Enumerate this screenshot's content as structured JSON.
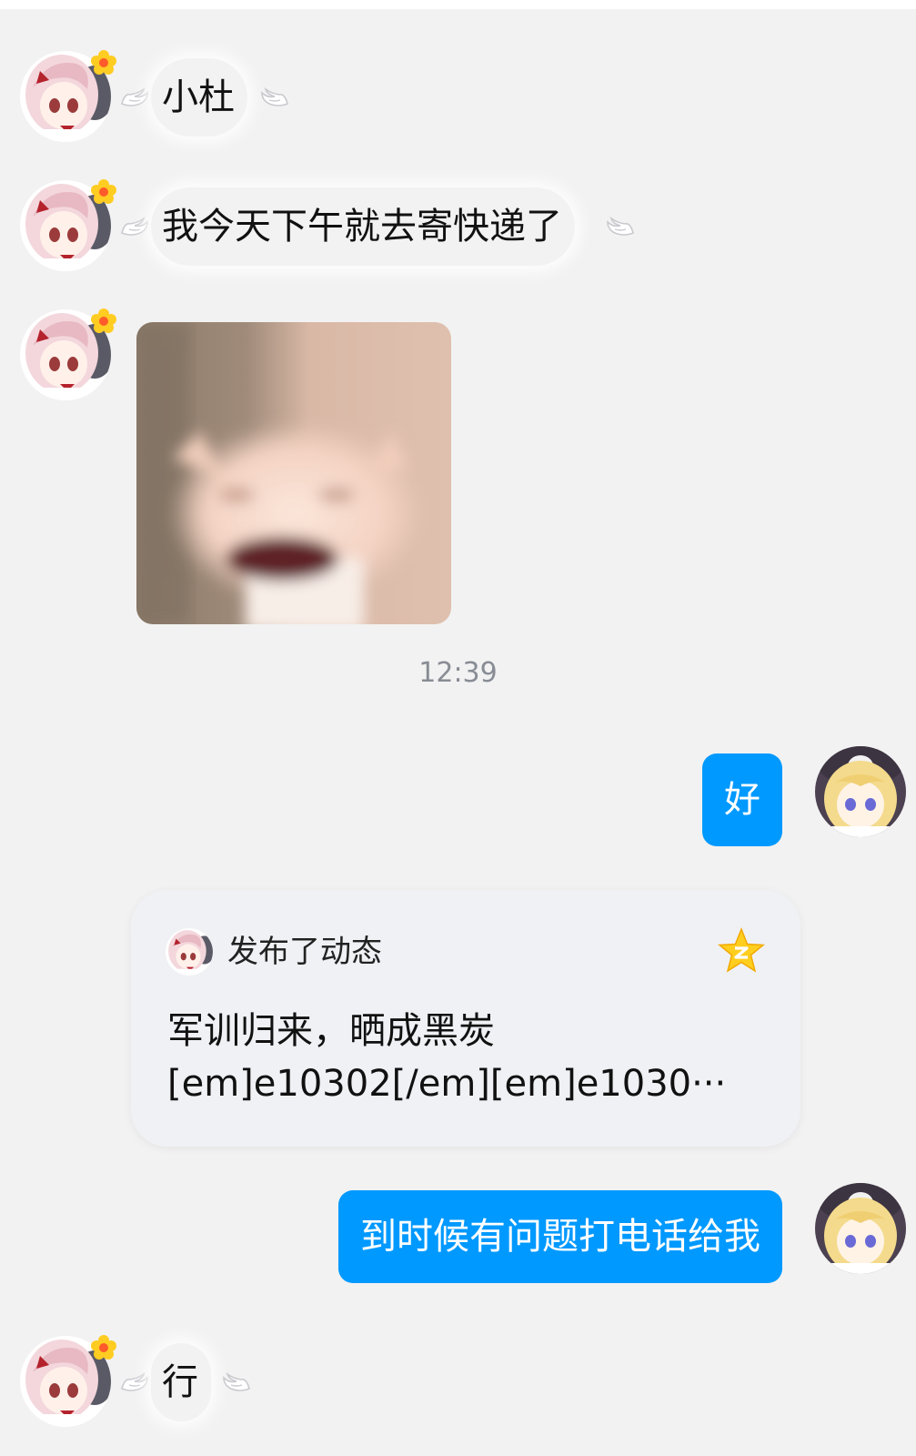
{
  "messages": [
    {
      "side": "left",
      "type": "text",
      "text": "小杜"
    },
    {
      "side": "left",
      "type": "text",
      "text": "我今天下午就去寄快递了"
    },
    {
      "side": "left",
      "type": "sticker",
      "sticker": "laughing-cat"
    },
    {
      "type": "timestamp",
      "text": "12:39"
    },
    {
      "side": "right",
      "type": "text",
      "text": "好"
    },
    {
      "side": "right",
      "type": "share-card",
      "header": "发布了动态",
      "icon": "qzone-star-icon",
      "body_line1": "军训归来，晒成黑炭",
      "body_line2": "[em]e10302[/em][em]e1030···"
    },
    {
      "side": "right",
      "type": "text",
      "text": "到时候有问题打电话给我"
    },
    {
      "side": "left",
      "type": "text",
      "text": "行"
    }
  ],
  "colors": {
    "background": "#f2f2f2",
    "outgoing_bubble": "#0099ff",
    "timestamp": "#888c94",
    "card": "#f0f1f5"
  }
}
